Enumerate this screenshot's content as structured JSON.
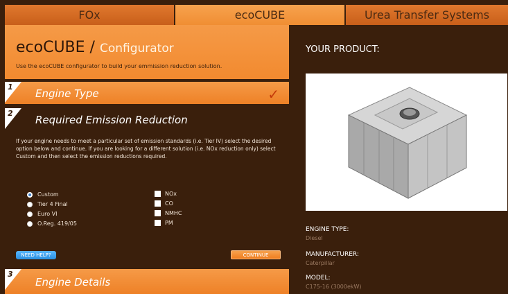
{
  "tabs": {
    "fox": "FOx",
    "ecocube": "ecoCUBE",
    "urea": "Urea Transfer Systems"
  },
  "header": {
    "title": "ecoCUBE /",
    "subtitle": "Configurator",
    "intro": "Use the ecoCUBE configurator to build your emmission reduction solution."
  },
  "steps": {
    "step1": {
      "number": "1",
      "title": "Engine Type",
      "done_icon": "checkmark-icon"
    },
    "step2": {
      "number": "2",
      "title": "Required Emission Reduction",
      "description": "If your engine needs to meet a particular set of emission standards (i.e. Tier IV) select the desired option below and continue. If you are looking for a different solution (i.e. NOx reduction only) select Custom and then select the emission reductions required.",
      "options": [
        "Custom",
        "Tier 4 Final",
        "Euro VI",
        "O.Reg. 419/05"
      ],
      "selected_option": "Custom",
      "reductions": [
        "NOx",
        "CO",
        "NMHC",
        "PM"
      ],
      "help_button": "NEED HELP?",
      "continue_button": "CONTINUE"
    },
    "step3": {
      "number": "3",
      "title": "Engine Details"
    }
  },
  "product": {
    "heading": "YOUR PRODUCT:",
    "engine_type_label": "ENGINE TYPE:",
    "engine_type_value": "Diesel",
    "manufacturer_label": "MANUFACTURER:",
    "manufacturer_value": "Caterpillar",
    "model_label": "MODEL:",
    "model_value": "C175-16 (3000ekW)"
  },
  "colors": {
    "accent_orange": "#f28a2f",
    "background_brown": "#3a1f0c",
    "help_blue": "#2a8fe0",
    "check_red": "#c43a0a"
  }
}
